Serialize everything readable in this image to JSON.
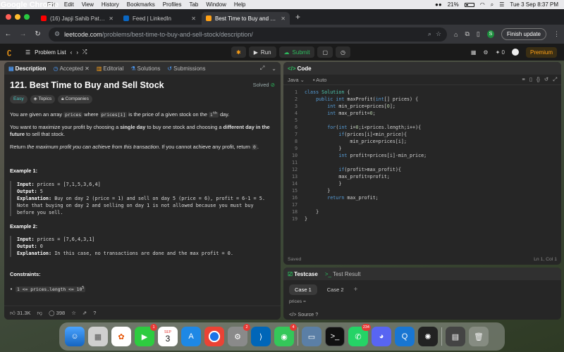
{
  "menubar": {
    "app_name": "Google Chrome",
    "items": [
      "File",
      "Edit",
      "View",
      "History",
      "Bookmarks",
      "Profiles",
      "Tab",
      "Window",
      "Help"
    ],
    "battery": "21%",
    "datetime": "Tue 3 Sep  8:37 PM"
  },
  "tabs": [
    {
      "title": "(16) Japji Sahib Path Full (Fas",
      "favicon_color": "#ff0000",
      "active": false
    },
    {
      "title": "Feed | LinkedIn",
      "favicon_color": "#0a66c2",
      "active": false
    },
    {
      "title": "Best Time to Buy and Sell Stoc",
      "favicon_color": "#ffa116",
      "active": true
    }
  ],
  "address": {
    "domain": "leetcode.com",
    "path": "/problems/best-time-to-buy-and-sell-stock/description/",
    "profile_initial": "S",
    "finish_update": "Finish update"
  },
  "lc_top": {
    "problem_list": "Problem List",
    "run": "Run",
    "submit": "Submit",
    "streak": "0",
    "premium": "Premium"
  },
  "desc_tabs": [
    "Description",
    "Accepted",
    "Editorial",
    "Solutions",
    "Submissions"
  ],
  "problem": {
    "title": "121. Best Time to Buy and Sell Stock",
    "status": "Solved",
    "difficulty": "Easy",
    "topics": "Topics",
    "companies": "Companies",
    "p1_a": "You are given an array ",
    "p1_code1": "prices",
    "p1_b": " where ",
    "p1_code2": "prices[i]",
    "p1_c": " is the price of a given stock on the ",
    "p1_d": "i",
    "p1_sup": "th",
    "p1_e": " day.",
    "p2_a": "You want to maximize your profit by choosing a ",
    "p2_b": "single day",
    "p2_c": " to buy one stock and choosing a ",
    "p2_d": "different day in the future",
    "p2_e": " to sell that stock.",
    "p3_a": "Return ",
    "p3_b": "the maximum profit you can achieve from this transaction",
    "p3_c": ". If you cannot achieve any profit, return ",
    "p3_code": "0",
    "p3_d": ".",
    "ex1_h": "Example 1:",
    "ex1_input_label": "Input:",
    "ex1_input": " prices = [7,1,5,3,6,4]",
    "ex1_output_label": "Output:",
    "ex1_output": " 5",
    "ex1_expl_label": "Explanation:",
    "ex1_expl": " Buy on day 2 (price = 1) and sell on day 5 (price = 6), profit = 6-1 = 5.",
    "ex1_note": "Note that buying on day 2 and selling on day 1 is not allowed because you must buy",
    "ex1_note2": "before you sell.",
    "ex2_h": "Example 2:",
    "ex2_input_label": "Input:",
    "ex2_input": " prices = [7,6,4,3,1]",
    "ex2_output_label": "Output:",
    "ex2_output": " 0",
    "ex2_expl_label": "Explanation:",
    "ex2_expl": " In this case, no transactions are done and the max profit = 0.",
    "constraints_h": "Constraints:",
    "constraint1": "1 <= prices.length <= 10",
    "constraint1_sup": "5"
  },
  "desc_footer": {
    "likes": "31.3K",
    "comments": "398"
  },
  "code": {
    "header": "Code",
    "language": "Java",
    "mode": "Auto",
    "line_numbers": [
      "1",
      "2",
      "3",
      "4",
      "5",
      "6",
      "7",
      "8",
      "9",
      "10",
      "11",
      "12",
      "13",
      "14",
      "15",
      "16",
      "17",
      "18",
      "19"
    ],
    "saved": "Saved",
    "cursor": "Ln 1, Col 1"
  },
  "testcase": {
    "tab1": "Testcase",
    "tab2": "Test Result",
    "case1": "Case 1",
    "case2": "Case 2",
    "label": "prices =",
    "source": "Source"
  },
  "dock": {
    "badges": {
      "facetime": "1",
      "calendar_month": "SEP",
      "calendar_day": "3",
      "settings": "2",
      "messages": "4",
      "whatsapp": "234"
    }
  }
}
